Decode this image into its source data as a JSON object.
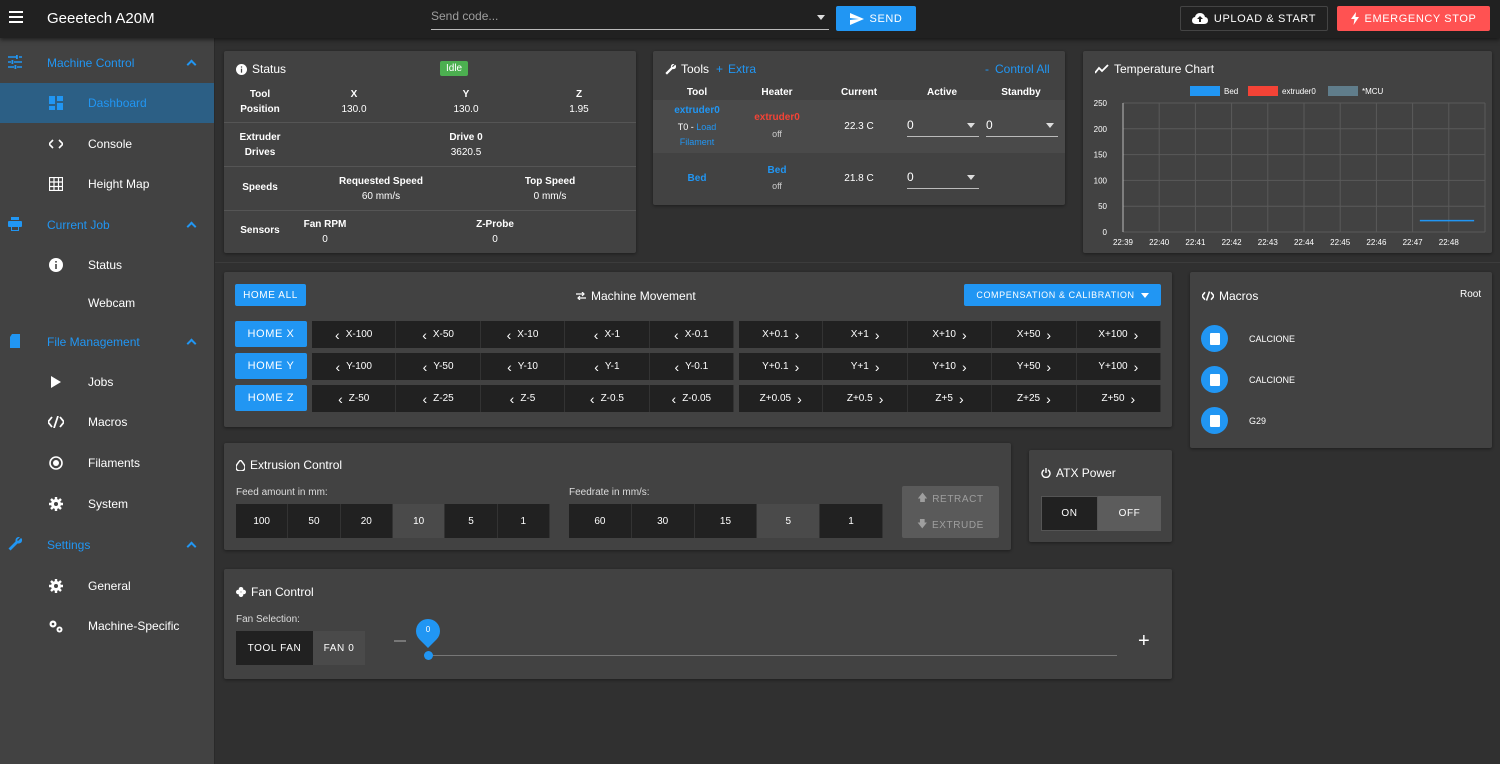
{
  "app": {
    "title": "Geeetech A20M"
  },
  "toolbar": {
    "send_placeholder": "Send code...",
    "send_label": "SEND",
    "upload_label": "UPLOAD & START",
    "estop_label": "EMERGENCY STOP"
  },
  "sidebar": {
    "groups": [
      {
        "label": "Machine Control",
        "items": [
          "Dashboard",
          "Console",
          "Height Map"
        ]
      },
      {
        "label": "Current Job",
        "items": [
          "Status",
          "Webcam"
        ]
      },
      {
        "label": "File Management",
        "items": [
          "Jobs",
          "Macros",
          "Filaments",
          "System"
        ]
      },
      {
        "label": "Settings",
        "items": [
          "General",
          "Machine-Specific"
        ]
      }
    ]
  },
  "status": {
    "title": "Status",
    "state": "Idle",
    "tool_label": "Tool",
    "position_label": "Position",
    "axes": [
      "X",
      "Y",
      "Z"
    ],
    "positions": [
      "130.0",
      "130.0",
      "1.95"
    ],
    "extruder_label": "Extruder",
    "drives_label": "Drives",
    "drive_name": "Drive 0",
    "drive_value": "3620.5",
    "speeds_label": "Speeds",
    "req_speed_label": "Requested Speed",
    "req_speed_value": "60 mm/s",
    "top_speed_label": "Top Speed",
    "top_speed_value": "0 mm/s",
    "sensors_label": "Sensors",
    "fan_rpm_label": "Fan RPM",
    "fan_rpm_value": "0",
    "zprobe_label": "Z-Probe",
    "zprobe_value": "0"
  },
  "tools": {
    "title": "Tools",
    "extra": "Extra",
    "control_all": "Control All",
    "headers": [
      "Tool",
      "Heater",
      "Current",
      "Active",
      "Standby"
    ],
    "row1": {
      "tool": "extruder0",
      "tool_sub1": "T0 -",
      "tool_sub2": "Load",
      "tool_sub3": "Filament",
      "heater": "extruder0",
      "heater_state": "off",
      "current": "22.3 C",
      "active": "0",
      "standby": "0"
    },
    "row2": {
      "tool": "Bed",
      "heater": "Bed",
      "heater_state": "off",
      "current": "21.8 C",
      "active": "0"
    }
  },
  "temp_chart": {
    "title": "Temperature Chart"
  },
  "chart_data": {
    "type": "line",
    "title": "Temperature Chart",
    "legend": [
      "Bed",
      "extruder0",
      "*MCU"
    ],
    "legend_position": "top",
    "x": [
      "22:39",
      "22:40",
      "22:41",
      "22:42",
      "22:43",
      "22:44",
      "22:45",
      "22:46",
      "22:47",
      "22:48"
    ],
    "yticks": [
      0,
      50,
      100,
      150,
      200,
      250
    ],
    "ylim": [
      0,
      250
    ],
    "grid": true,
    "series": [
      {
        "name": "Bed",
        "color": "#2196f3",
        "points": [
          [
            8.2,
            22
          ],
          [
            9.7,
            22
          ]
        ]
      }
    ]
  },
  "movement": {
    "home_all": "HOME ALL",
    "title": "Machine Movement",
    "comp_label": "COMPENSATION & CALIBRATION",
    "rows": [
      {
        "home": "HOME X",
        "neg": [
          "X-100",
          "X-50",
          "X-10",
          "X-1",
          "X-0.1"
        ],
        "pos": [
          "X+0.1",
          "X+1",
          "X+10",
          "X+50",
          "X+100"
        ]
      },
      {
        "home": "HOME Y",
        "neg": [
          "Y-100",
          "Y-50",
          "Y-10",
          "Y-1",
          "Y-0.1"
        ],
        "pos": [
          "Y+0.1",
          "Y+1",
          "Y+10",
          "Y+50",
          "Y+100"
        ]
      },
      {
        "home": "HOME Z",
        "neg": [
          "Z-50",
          "Z-25",
          "Z-5",
          "Z-0.5",
          "Z-0.05"
        ],
        "pos": [
          "Z+0.05",
          "Z+0.5",
          "Z+5",
          "Z+25",
          "Z+50"
        ]
      }
    ]
  },
  "macros": {
    "title": "Macros",
    "root": "Root",
    "items": [
      "CALCIONE",
      "CALCIONE",
      "G29"
    ]
  },
  "extrusion": {
    "title": "Extrusion Control",
    "feed_label": "Feed amount in mm:",
    "feed_values": [
      "100",
      "50",
      "20",
      "10",
      "5",
      "1"
    ],
    "feed_selected": "10",
    "rate_label": "Feedrate in mm/s:",
    "rate_values": [
      "60",
      "30",
      "15",
      "5",
      "1"
    ],
    "rate_selected": "5",
    "retract": "RETRACT",
    "extrude": "EXTRUDE"
  },
  "atx": {
    "title": "ATX Power",
    "on": "ON",
    "off": "OFF"
  },
  "fan": {
    "title": "Fan Control",
    "selection_label": "Fan Selection:",
    "tool_fan": "TOOL FAN",
    "fan0": "FAN 0",
    "value": "0"
  }
}
